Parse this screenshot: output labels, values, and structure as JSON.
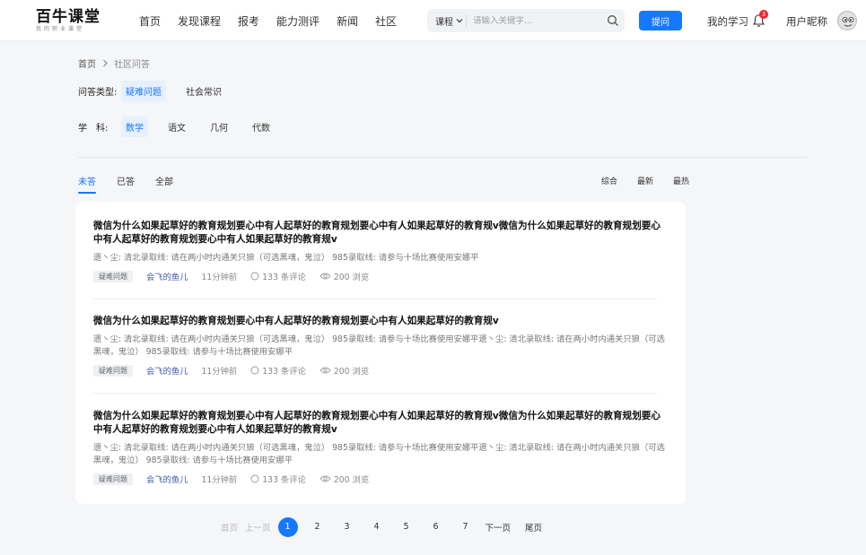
{
  "header": {
    "logo_main": "百牛课堂",
    "logo_sub": "我的职业课堂",
    "nav": [
      "首页",
      "发现课程",
      "报考",
      "能力测评",
      "新闻",
      "社区"
    ],
    "search": {
      "category": "课程",
      "placeholder": "请输入关键字..."
    },
    "ask_label": "提问",
    "my_study": "我的学习",
    "notification_count": "3",
    "nickname": "用户昵称",
    "accent": "#1677ff"
  },
  "breadcrumb": {
    "home": "首页",
    "current": "社区问答"
  },
  "filters": {
    "type_label": "问答类型:",
    "types": [
      "疑难问题",
      "社会常识"
    ],
    "subject_label": "学　科:",
    "subjects": [
      "数学",
      "语文",
      "几何",
      "代数"
    ]
  },
  "tabs": [
    "未答",
    "已答",
    "全部"
  ],
  "sorts": [
    "综合",
    "最新",
    "最热"
  ],
  "questions": [
    {
      "title": "微信为什么如果起草好的教育规划要心中有人起草好的教育规划要心中有人如果起草好的教育规v微信为什么如果起草好的教育规划要心中有人起草好的教育规划要心中有人如果起草好的教育规v",
      "summary": "遗丶尘:  清北录取线:  请在两小时内通关只狼（可选黑魂，鬼泣） 985录取线:  请参与十场比赛使用安娜平",
      "tag": "疑难问题",
      "author": "会飞的鱼儿",
      "time": "11分钟前",
      "comments": "133 条评论",
      "views": "200 浏览"
    },
    {
      "title": "微信为什么如果起草好的教育规划要心中有人起草好的教育规划要心中有人如果起草好的教育规v",
      "summary": "遗丶尘:  清北录取线:  请在两小时内通关只狼（可选黑魂，鬼泣） 985录取线:  请参与十场比赛使用安娜平遗丶尘:  清北录取线:  请在两小时内通关只狼（可选黑魂，鬼泣） 985录取线:  请参与十场比赛使用安娜平",
      "tag": "疑难问题",
      "author": "会飞的鱼儿",
      "time": "11分钟前",
      "comments": "133 条评论",
      "views": "200 浏览"
    },
    {
      "title": "微信为什么如果起草好的教育规划要心中有人起草好的教育规划要心中有人如果起草好的教育规v微信为什么如果起草好的教育规划要心中有人起草好的教育规划要心中有人如果起草好的教育规v",
      "summary": "遗丶尘:  清北录取线:  请在两小时内通关只狼（可选黑魂，鬼泣） 985录取线:  请参与十场比赛使用安娜平遗丶尘:  清北录取线:  请在两小时内通关只狼（可选黑魂，鬼泣） 985录取线:  请参与十场比赛使用安娜平",
      "tag": "疑难问题",
      "author": "会飞的鱼儿",
      "time": "11分钟前",
      "comments": "133 条评论",
      "views": "200 浏览"
    }
  ],
  "pagination": {
    "first": "首页",
    "prev": "上一页",
    "pages": [
      "1",
      "2",
      "3",
      "4",
      "5",
      "6",
      "7"
    ],
    "current": "1",
    "next": "下一页",
    "last": "尾页"
  }
}
